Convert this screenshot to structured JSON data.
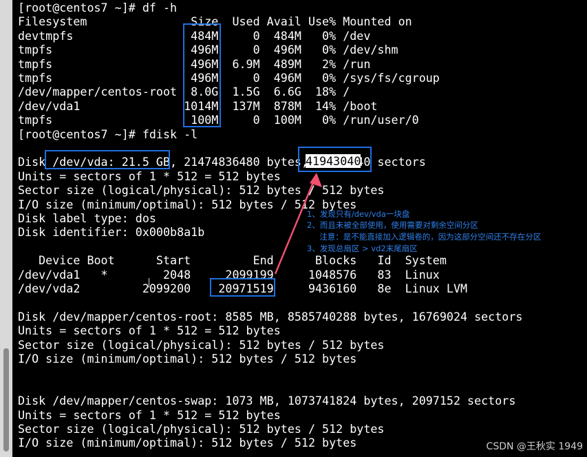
{
  "terminal": {
    "lines": [
      "[root@centos7 ~]# df -h",
      "Filesystem               Size  Used Avail Use% Mounted on",
      "devtmpfs                 484M     0  484M   0% /dev",
      "tmpfs                    496M     0  496M   0% /dev/shm",
      "tmpfs                    496M  6.9M  489M   2% /run",
      "tmpfs                    496M     0  496M   0% /sys/fs/cgroup",
      "/dev/mapper/centos-root  8.0G  1.5G  6.6G  18% /",
      "/dev/vda1               1014M  137M  878M  14% /boot",
      "tmpfs                    100M     0  100M   0% /run/user/0",
      "[root@centos7 ~]# fdisk -l",
      "",
      "Disk /dev/vda: 21.5 GB, 21474836480 bytes, 41943040 sectors",
      "Units = sectors of 1 * 512 = 512 bytes",
      "Sector size (logical/physical): 512 bytes / 512 bytes",
      "I/O size (minimum/optimal): 512 bytes / 512 bytes",
      "Disk label type: dos",
      "Disk identifier: 0x000b8a1b",
      "",
      "   Device Boot      Start         End      Blocks   Id  System",
      "/dev/vda1   *        2048     2099199     1048576   83  Linux",
      "/dev/vda2         2099200    20971519     9436160   8e  Linux LVM",
      "",
      "Disk /dev/mapper/centos-root: 8585 MB, 8585740288 bytes, 16769024 sectors",
      "Units = sectors of 1 * 512 = 512 bytes",
      "Sector size (logical/physical): 512 bytes / 512 bytes",
      "I/O size (minimum/optimal): 512 bytes / 512 bytes",
      "",
      "",
      "Disk /dev/mapper/centos-swap: 1073 MB, 1073741824 bytes, 2097152 sectors",
      "Units = sectors of 1 * 512 = 512 bytes",
      "Sector size (logical/physical): 512 bytes / 512 bytes",
      "I/O size (minimum/optimal): 512 bytes / 512 bytes"
    ],
    "selected_text": "41943040"
  },
  "annotations": {
    "notes": [
      "1、发现只有/dev/vda一块盘",
      "2、而且未被全部使用，使用需要对剩余空间分区",
      "     注意：是不能直接加入逻辑卷的，因为这部分空间还不存在分区",
      "3、发现总扇区 > vd2末尾扇区"
    ],
    "color": "#2f7fe8",
    "box_color": "#1e6fe0",
    "arrow_color": "#f0506e"
  },
  "watermark": "CSDN @王秋实 1949"
}
